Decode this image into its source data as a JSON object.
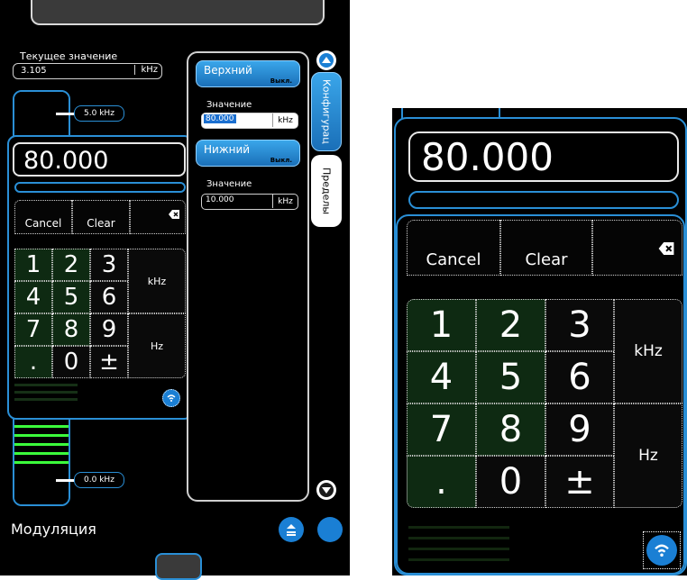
{
  "left": {
    "current_value_label": "Текущее значение",
    "current_value": "3.105",
    "current_unit": "kHz",
    "slider_upper_marker": "5.0 kHz",
    "slider_lower_marker": "0.0 kHz",
    "entry_value": "80.000",
    "keypad": {
      "cancel": "Cancel",
      "clear": "Clear",
      "digits": [
        "1",
        "2",
        "3",
        "4",
        "5",
        "6",
        "7",
        "8",
        "9",
        ".",
        "0",
        "±"
      ],
      "unit_khz": "kHz",
      "unit_hz": "Hz"
    },
    "limits": {
      "upper_button": "Верхний",
      "upper_state": "Выкл.",
      "upper_value_label": "Значение",
      "upper_value": "80.000",
      "upper_unit": "kHz",
      "lower_button": "Нижний",
      "lower_state": "Выкл.",
      "lower_value_label": "Значение",
      "lower_value": "10.000",
      "lower_unit": "kHz"
    },
    "tabs": {
      "config": "Конфигурац",
      "limits": "Пределы"
    },
    "footer_title": "Модуляция"
  },
  "right": {
    "entry_value": "80.000",
    "keypad": {
      "cancel": "Cancel",
      "clear": "Clear",
      "digits": [
        "1",
        "2",
        "3",
        "4",
        "5",
        "6",
        "7",
        "8",
        "9",
        ".",
        "0",
        "±"
      ],
      "unit_khz": "kHz",
      "unit_hz": "Hz"
    }
  },
  "colors": {
    "accent_blue": "#2a8fd6",
    "key_green": "#0e2a12",
    "level_green": "#3cff3c"
  },
  "icons": [
    "backspace-icon",
    "up-arrow-icon",
    "down-arrow-icon",
    "wifi-icon",
    "collapse-icon",
    "circle-button-icon"
  ]
}
